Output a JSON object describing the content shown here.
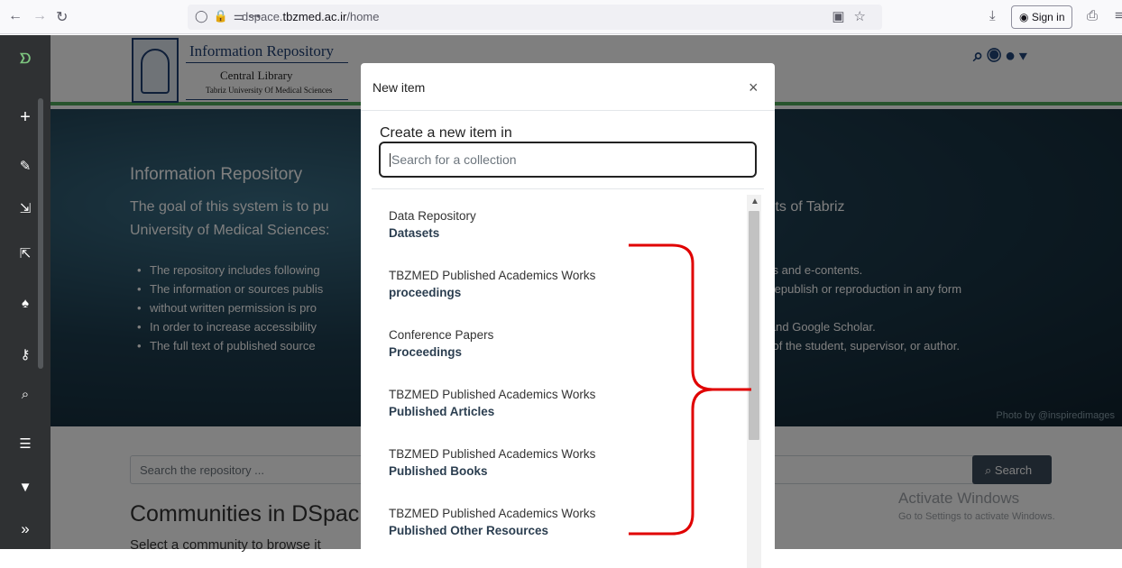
{
  "browser": {
    "url_host_prefix": "dspace.",
    "url_host_bold": "tbzmed.ac.ir",
    "url_path": "/home",
    "sign_in_label": "Sign in"
  },
  "header": {
    "logo_title": "Information Repository",
    "logo_sub1": "Central Library",
    "logo_sub2": "Tabriz University Of Medical Sciences"
  },
  "hero": {
    "title": "Information Repository",
    "intro_left": "The goal of this system is to pu",
    "intro_right": "s, staff, and students of Tabriz",
    "intro_line2": "University of Medical Sciences:",
    "bullets": [
      {
        "left": "The repository includes following",
        "right": "s, books and e-contents."
      },
      {
        "left": "The information or sources publis",
        "right": "e, but republish or reproduction in any form"
      },
      {
        "left": "without written permission is pro",
        "right": ""
      },
      {
        "left": "In order to increase accessibility",
        "right": "ngines and Google Scholar."
      },
      {
        "left": "The full text of published source",
        "right": "request of the student, supervisor, or author."
      }
    ],
    "photo_credit": "Photo by @inspiredimages"
  },
  "search": {
    "placeholder": "Search the repository ...",
    "button_label": "Search"
  },
  "communities": {
    "title": "Communities in DSpac",
    "subtitle": "Select a community to browse it"
  },
  "watermark": {
    "title": "Activate Windows",
    "subtitle": "Go to Settings to activate Windows."
  },
  "modal": {
    "title": "New item",
    "close_symbol": "×",
    "create_label": "Create a new item in",
    "search_placeholder": "Search for a collection",
    "collections": [
      {
        "parent": "Data Repository",
        "name": "Datasets"
      },
      {
        "parent": "TBZMED Published Academics Works",
        "name": "proceedings"
      },
      {
        "parent": "Conference Papers",
        "name": "Proceedings"
      },
      {
        "parent": "TBZMED Published Academics Works",
        "name": "Published Articles"
      },
      {
        "parent": "TBZMED Published Academics Works",
        "name": "Published Books"
      },
      {
        "parent": "TBZMED Published Academics Works",
        "name": "Published Other Resources"
      }
    ]
  },
  "colors": {
    "sidebar": "#2f3133",
    "header_accent": "#4fa95a",
    "annotation": "#e00000",
    "collection_name": "#2b3e50"
  }
}
